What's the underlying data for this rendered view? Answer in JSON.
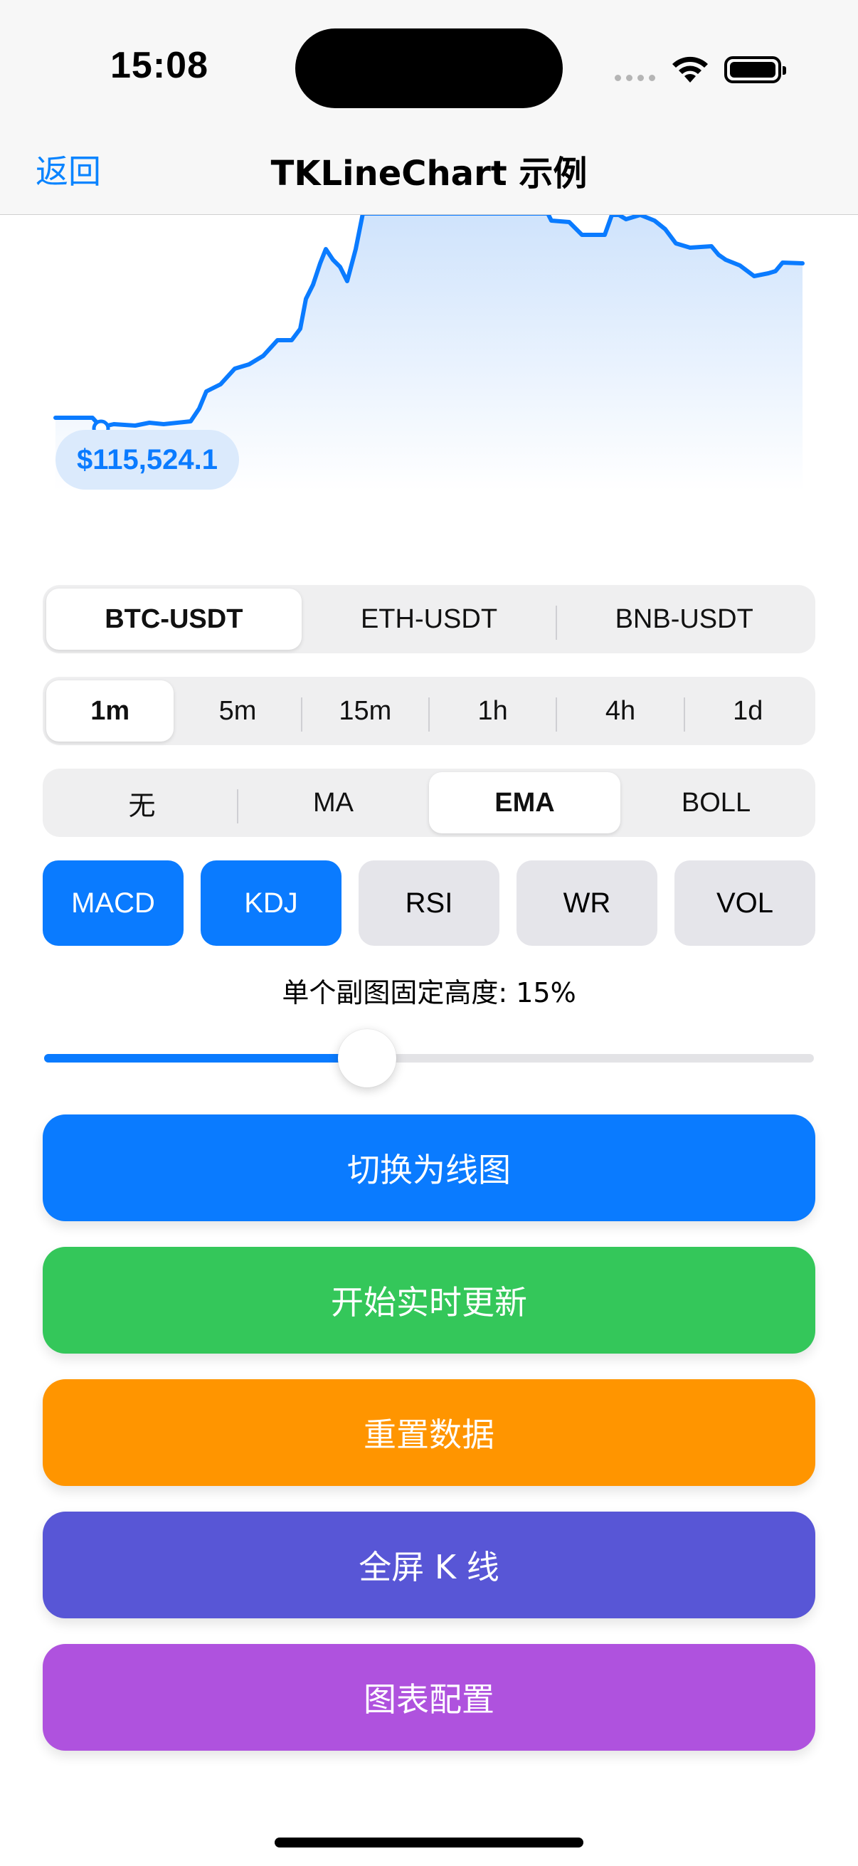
{
  "status_bar": {
    "time": "15:08"
  },
  "nav": {
    "back_label": "返回",
    "title": "TKLineChart 示例"
  },
  "chart": {
    "price_label": "$115,524.1",
    "line_color": "#0a7bff",
    "fill_color": "#d6e8fd"
  },
  "symbols": {
    "items": [
      "BTC-USDT",
      "ETH-USDT",
      "BNB-USDT"
    ],
    "selected": 0
  },
  "intervals": {
    "items": [
      "1m",
      "5m",
      "15m",
      "1h",
      "4h",
      "1d"
    ],
    "selected": 0
  },
  "main_indicators": {
    "items": [
      "无",
      "MA",
      "EMA",
      "BOLL"
    ],
    "selected": 2
  },
  "sub_indicators": {
    "items": [
      {
        "label": "MACD",
        "active": true
      },
      {
        "label": "KDJ",
        "active": true
      },
      {
        "label": "RSI",
        "active": false
      },
      {
        "label": "WR",
        "active": false
      },
      {
        "label": "VOL",
        "active": false
      }
    ]
  },
  "slider": {
    "label": "单个副图固定高度: 15%",
    "fraction": 0.42
  },
  "actions": {
    "switch_line": {
      "label": "切换为线图",
      "color": "#0a7bff"
    },
    "realtime": {
      "label": "开始实时更新",
      "color": "#34c75a"
    },
    "reset": {
      "label": "重置数据",
      "color": "#ff9500"
    },
    "fullscreen": {
      "label": "全屏 K 线",
      "color": "#5856d6"
    },
    "config": {
      "label": "图表配置",
      "color": "#af52de"
    }
  }
}
